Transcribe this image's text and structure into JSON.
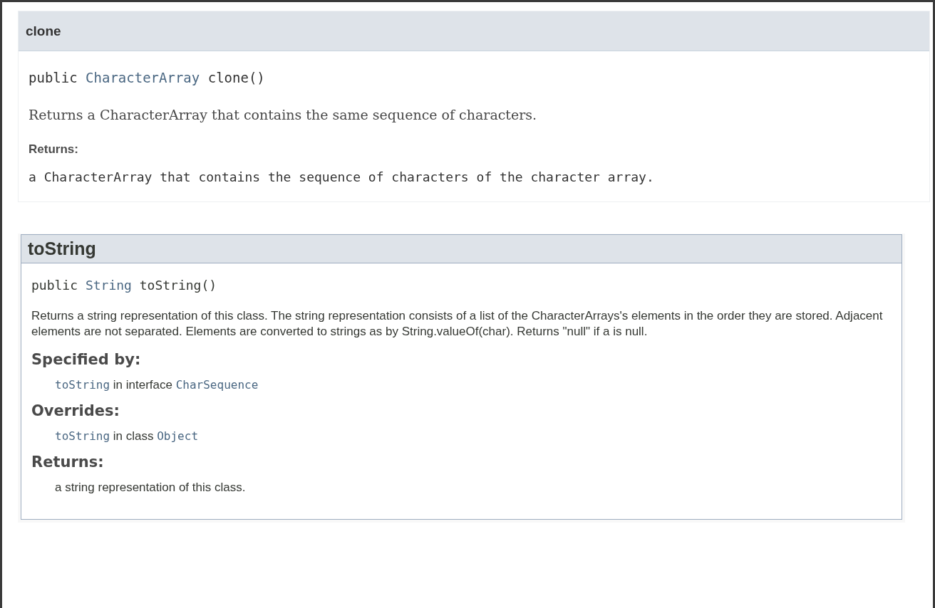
{
  "sections": [
    {
      "kind": "plain",
      "name": "clone",
      "signature": {
        "modifier": "public",
        "return_type": "CharacterArray",
        "method": "clone()"
      },
      "description": "Returns a CharacterArray that contains the same sequence of characters.",
      "blocks": [
        {
          "heading": "Returns:",
          "entries": [
            {
              "kind": "code",
              "text": "a CharacterArray that contains the sequence of characters of the character array."
            }
          ]
        }
      ]
    },
    {
      "kind": "boxed",
      "name": "toString",
      "signature": {
        "modifier": "public",
        "return_type": "String",
        "method": "toString()"
      },
      "description": "Returns a string representation of this class. The string representation consists of a list of the CharacterArrays's elements in the order they are stored. Adjacent elements are not separated. Elements are converted to strings as by String.valueOf(char). Returns \"null\" if a is null.",
      "blocks": [
        {
          "heading": "Specified by:",
          "entries": [
            {
              "kind": "ref",
              "link": "toString",
              "text": "in interface",
              "target": "CharSequence"
            }
          ]
        },
        {
          "heading": "Overrides:",
          "entries": [
            {
              "kind": "ref",
              "link": "toString",
              "text": "in class",
              "target": "Object"
            }
          ]
        },
        {
          "heading": "Returns:",
          "entries": [
            {
              "kind": "text",
              "text": "a string representation of this class."
            }
          ]
        }
      ]
    }
  ]
}
